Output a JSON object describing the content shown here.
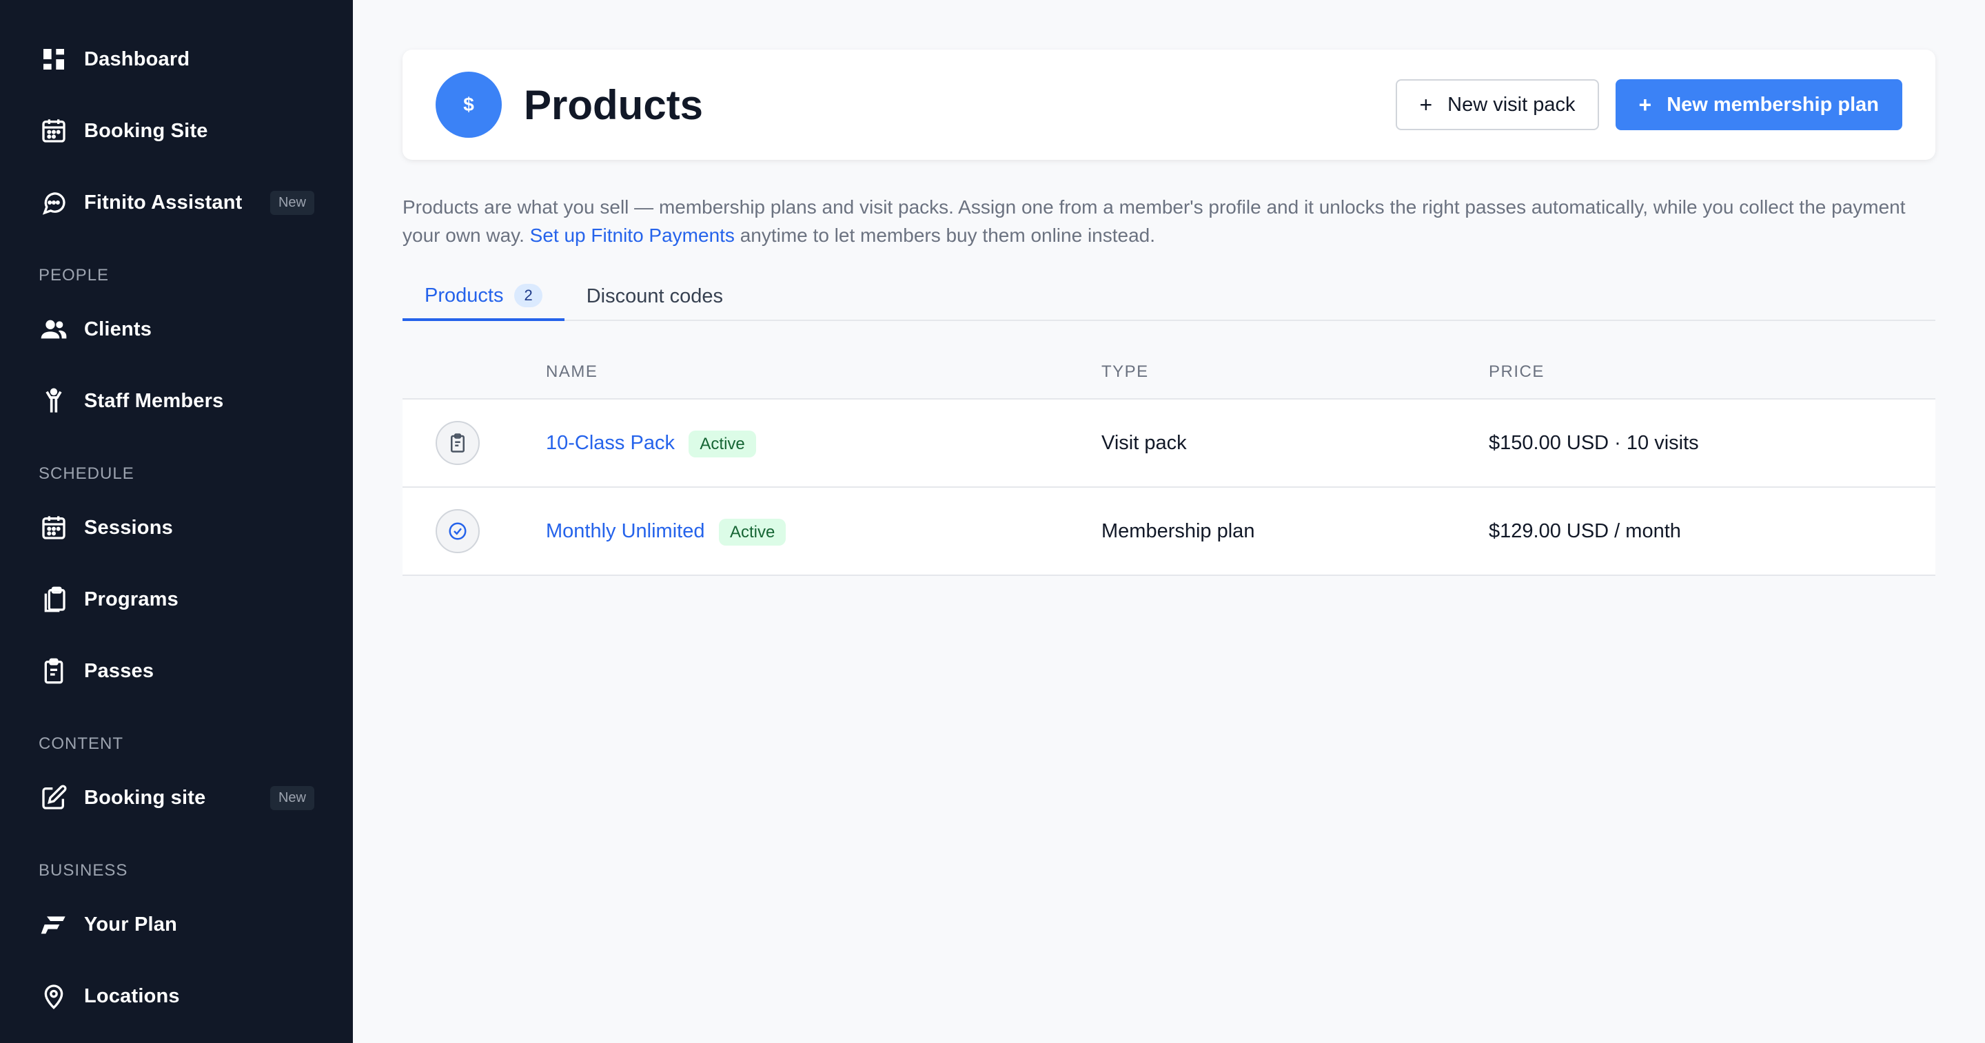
{
  "sidebar": {
    "top_items": [
      {
        "label": "Dashboard",
        "icon": "dashboard-icon"
      },
      {
        "label": "Booking Site",
        "icon": "calendar-icon"
      },
      {
        "label": "Fitnito Assistant",
        "icon": "chat-icon",
        "badge": "New"
      }
    ],
    "sections": {
      "people": {
        "label": "PEOPLE",
        "items": [
          {
            "label": "Clients",
            "icon": "users-icon"
          },
          {
            "label": "Staff Members",
            "icon": "person-icon"
          }
        ]
      },
      "schedule": {
        "label": "SCHEDULE",
        "items": [
          {
            "label": "Sessions",
            "icon": "calendar-icon"
          },
          {
            "label": "Programs",
            "icon": "copy-icon"
          },
          {
            "label": "Passes",
            "icon": "clipboard-icon"
          }
        ]
      },
      "content": {
        "label": "CONTENT",
        "items": [
          {
            "label": "Booking site",
            "icon": "edit-icon",
            "badge": "New"
          }
        ]
      },
      "business": {
        "label": "BUSINESS",
        "items": [
          {
            "label": "Your Plan",
            "icon": "fitnito-logo-icon"
          },
          {
            "label": "Locations",
            "icon": "map-pin-icon"
          }
        ]
      }
    }
  },
  "header": {
    "icon_symbol": "$",
    "title": "Products",
    "new_visit_pack_label": "New visit pack",
    "new_membership_plan_label": "New membership plan",
    "plus": "+"
  },
  "description": {
    "text_before": "Products are what you sell — membership plans and visit packs. Assign one from a member's profile and it unlocks the right passes automatically, while you collect the payment your own way. ",
    "link": "Set up Fitnito Payments",
    "text_after": " anytime to let members buy them online instead."
  },
  "tabs": [
    {
      "label": "Products",
      "count": "2",
      "active": true
    },
    {
      "label": "Discount codes",
      "active": false
    }
  ],
  "table": {
    "columns": [
      "NAME",
      "TYPE",
      "PRICE"
    ],
    "rows": [
      {
        "icon": "clipboard-icon",
        "name": "10-Class Pack",
        "status": "Active",
        "type": "Visit pack",
        "price": "$150.00 USD · 10 visits"
      },
      {
        "icon": "check-circle-icon",
        "name": "Monthly Unlimited",
        "status": "Active",
        "type": "Membership plan",
        "price": "$129.00 USD / month"
      }
    ]
  },
  "colors": {
    "sidebar_bg": "#111827",
    "accent": "#3b82f6",
    "link": "#2563eb",
    "active_badge_bg": "#dcfce7",
    "active_badge_text": "#166534"
  }
}
